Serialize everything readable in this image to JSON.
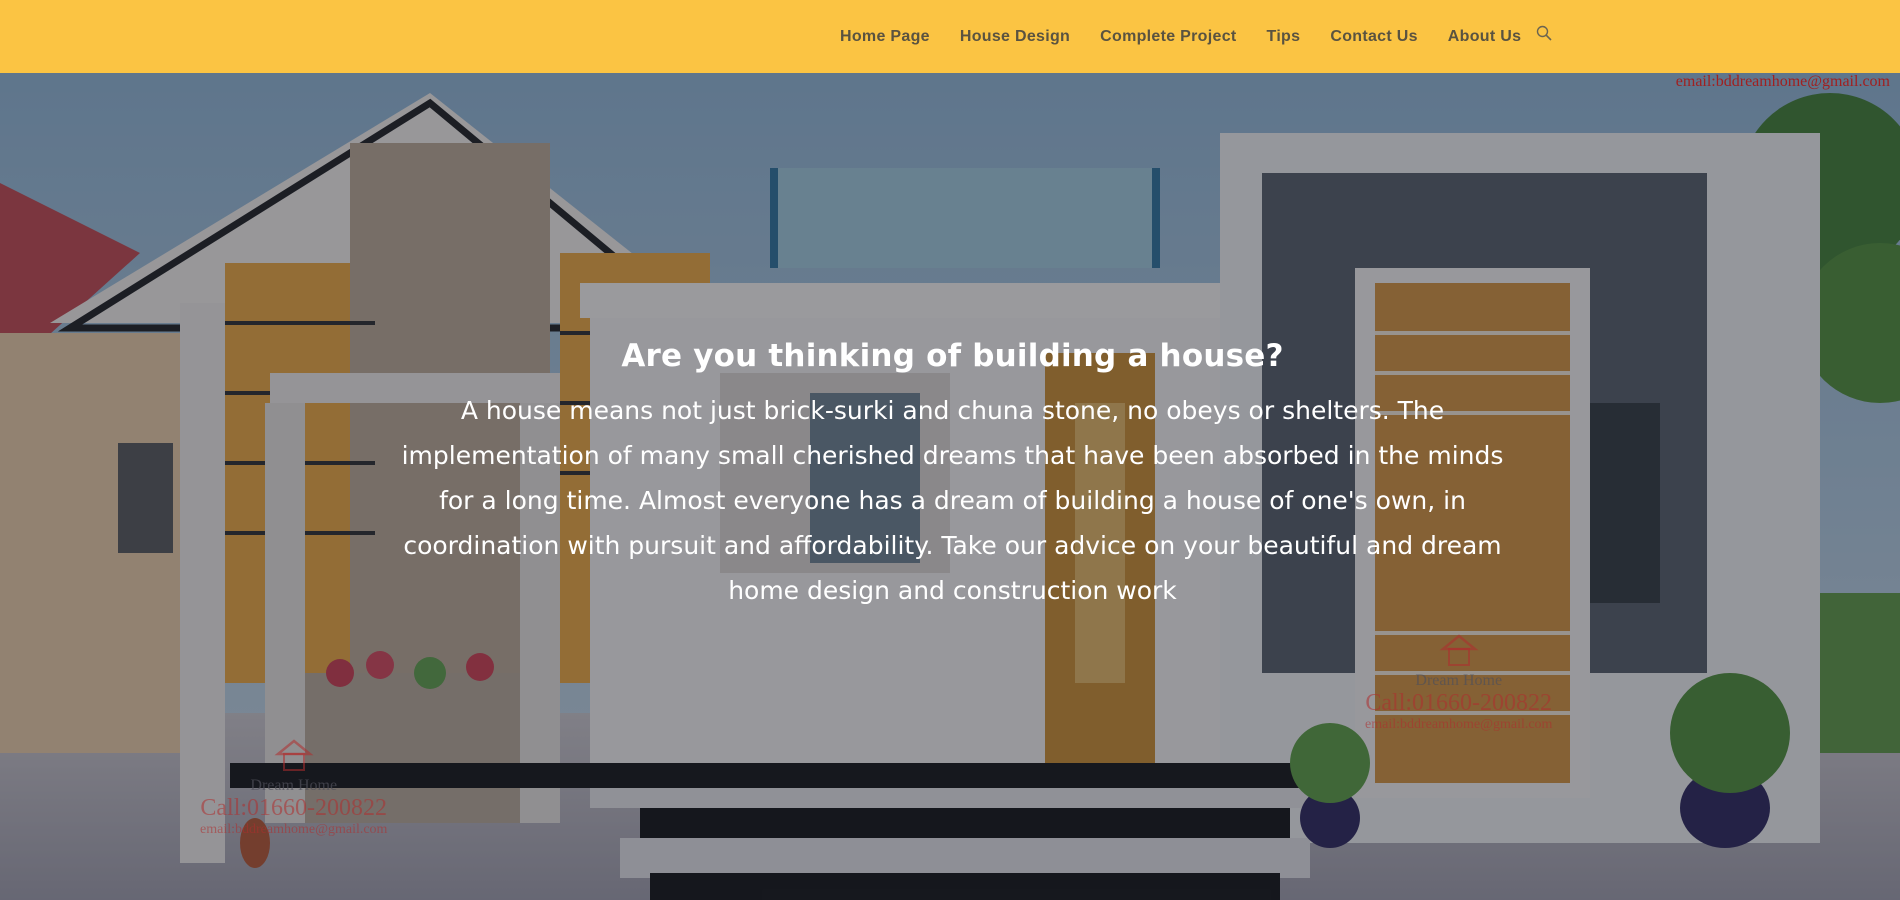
{
  "nav": {
    "items": [
      {
        "label": "Home Page"
      },
      {
        "label": "House Design"
      },
      {
        "label": "Complete Project"
      },
      {
        "label": "Tips"
      },
      {
        "label": "Contact Us"
      },
      {
        "label": "About Us"
      }
    ],
    "search_icon": "search-icon"
  },
  "hero": {
    "title": "Are you thinking of building a house?",
    "text": "A house means not just brick-surki and chuna stone, no obeys or shelters. The implementation of many small cherished dreams that have been absorbed in the minds for a long time. Almost everyone has a dream of building a house of one's own, in coordination with pursuit and affordability. Take our advice on your beautiful and dream home design and construction work"
  },
  "watermarks": {
    "top_email": "email:bddreamhome@gmail.com",
    "brand": "Dream Home",
    "call": "Call:01660-200822",
    "email": "email:bddreamhome@gmail.com"
  },
  "colors": {
    "header_bg": "#fbc443",
    "nav_text": "#5a5340"
  }
}
